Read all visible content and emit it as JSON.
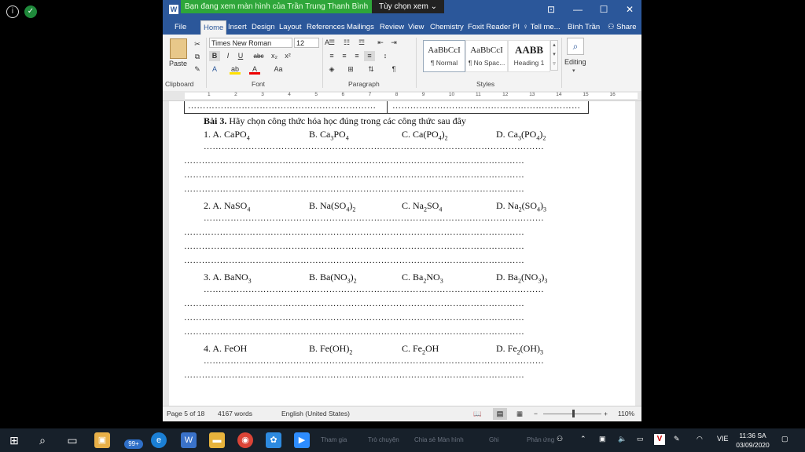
{
  "overlay": {
    "info_icon": "info-icon",
    "shield_icon": "shield-icon"
  },
  "share_banner": {
    "text": "Bạn đang xem màn hình của Trần Trung Thanh Bình",
    "options_label": "Tùy chọn xem"
  },
  "word": {
    "title_buttons": [
      "⊡",
      "—",
      "☐",
      "✕"
    ],
    "tabs": [
      "File",
      "Home",
      "Insert",
      "Design",
      "Layout",
      "References",
      "Mailings",
      "Review",
      "View",
      "Chemistry",
      "Foxit Reader PI",
      "Tell me...",
      "Bình Trần",
      "Share"
    ],
    "ribbon": {
      "paste_label": "Paste",
      "clipboard_label": "Clipboard",
      "font_name": "Times New Roman",
      "font_size": "12",
      "font_label": "Font",
      "paragraph_label": "Paragraph",
      "styles_label": "Styles",
      "editing_label": "Editing",
      "styles": [
        {
          "preview": "AaBbCcI",
          "name": "¶ Normal"
        },
        {
          "preview": "AaBbCcI",
          "name": "¶ No Spac..."
        },
        {
          "preview": "AABB",
          "name": "Heading 1"
        }
      ]
    },
    "ruler_numbers": [
      "1",
      "2",
      "3",
      "4",
      "5",
      "6",
      "7",
      "8",
      "9",
      "10",
      "11",
      "12",
      "13",
      "14",
      "15",
      "16"
    ],
    "document": {
      "table_dots_left": "………………………………………………………",
      "table_dots_right": "………………………………………………………",
      "heading_bold": "Bài 3.",
      "heading_text": " Hãy chọn công thức hóa học đúng trong các công thức sau đây",
      "dots_line": "……………………………………………………………………………………………………",
      "questions": [
        {
          "a": "1. A. CaPO4",
          "b": "B. Ca3PO4",
          "c": "C. Ca(PO4)2",
          "d": "D. Ca3(PO4)2"
        },
        {
          "a": "2. A. NaSO4",
          "b": "B. Na(SO4)2",
          "c": "C. Na2SO4",
          "d": "D. Na2(SO4)3"
        },
        {
          "a": "3. A. BaNO3",
          "b": "B. Ba(NO3)2",
          "c": "C. Ba2NO3",
          "d": "D. Ba2(NO3)3"
        },
        {
          "a": "4. A. FeOH",
          "b": "B. Fe(OH)2",
          "c": "C. Fe2OH",
          "d": "D. Fe2(OH)3"
        }
      ]
    },
    "status": {
      "page": "Page 5 of 18",
      "words": "4167 words",
      "language": "English (United States)",
      "zoom": "110%"
    }
  },
  "taskbar": {
    "badge": "99+",
    "ghost_labels": [
      "Tham gia",
      "Trò chuyện",
      "Chia sẻ Màn hình",
      "Ghi",
      "Phản ứng"
    ],
    "language": "VIE",
    "time": "11:36 SA",
    "date": "03/09/2020"
  }
}
